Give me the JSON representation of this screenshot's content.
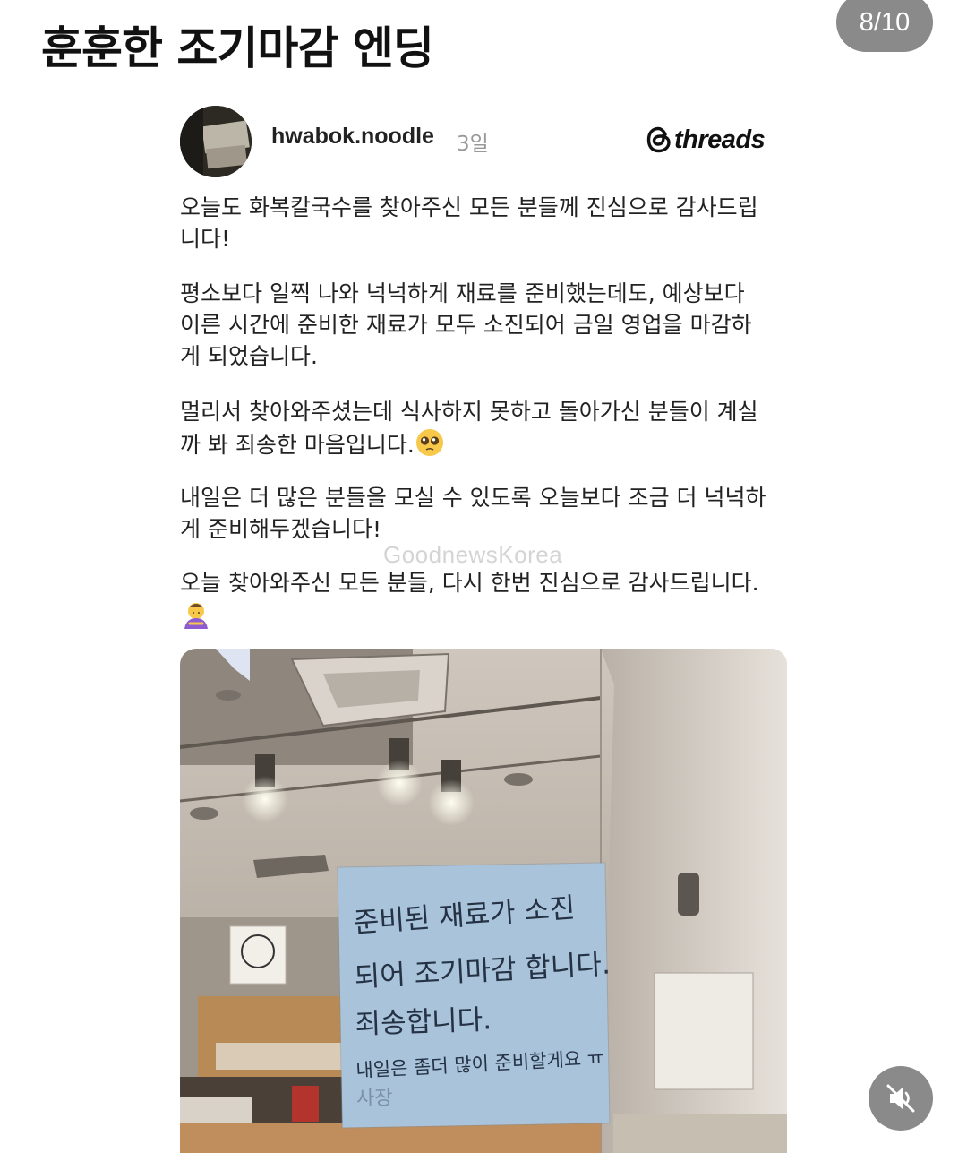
{
  "header": {
    "title": "훈훈한 조기마감 엔딩",
    "page_counter": "8/10"
  },
  "post": {
    "username": "hwabok.noodle",
    "age": "3일",
    "platform_label": "threads",
    "paragraphs": [
      {
        "lines": [
          "오늘도 화복칼국수를 찾아주신 모든 분들께 진심으로 감사드립",
          "니다!"
        ]
      },
      {
        "lines": [
          "평소보다 일찍 나와 넉넉하게 재료를 준비했는데도, 예상보다",
          "이른 시간에 준비한 재료가 모두 소진되어 금일 영업을 마감하",
          "게 되었습니다."
        ]
      },
      {
        "lines": [
          "멀리서 찾아와주셨는데 식사하지 못하고 돌아가신 분들이 계실",
          "까 봐 죄송한 마음입니다."
        ],
        "emoji": "pleading-face-icon"
      },
      {
        "lines": [
          "내일은 더 많은 분들을 모실 수 있도록 오늘보다 조금 더 넉넉하",
          "게 준비해두겠습니다!"
        ]
      },
      {
        "lines": [
          "오늘 찾아와주신 모든 분들, 다시 한번 진심으로 감사드립니다."
        ],
        "emoji_line": "bowing-person-icon"
      }
    ],
    "watermark": "GoodnewsKorea"
  },
  "photo": {
    "notice_lines": [
      "준비된 재료가 소진",
      "되어 조기마감 합니다.",
      "죄송합니다.",
      "내일은 좀더 많이 준비할게요 ㅠ",
      "사장"
    ]
  },
  "controls": {
    "mute_icon": "speaker-muted-icon"
  }
}
